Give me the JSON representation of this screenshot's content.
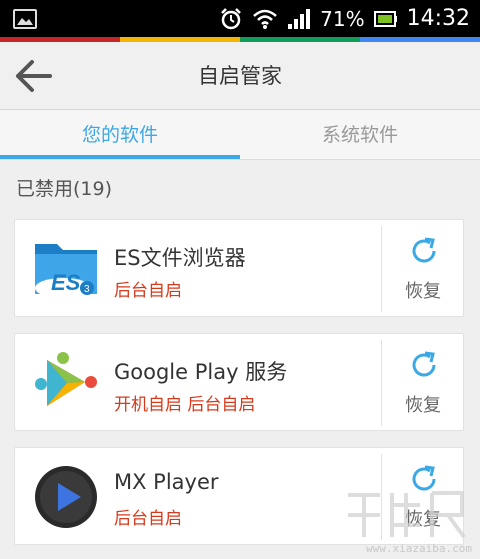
{
  "status_bar": {
    "battery_percent": "71%",
    "time": "14:32",
    "icons": [
      "gallery-icon",
      "alarm-icon",
      "wifi-icon",
      "signal-icon",
      "battery-icon"
    ],
    "strip_colors": [
      "#c62828",
      "#f4b400",
      "#0f9d58",
      "#4285f4"
    ]
  },
  "action_bar": {
    "title": "自启管家"
  },
  "tabs": [
    {
      "label": "您的软件",
      "active": true
    },
    {
      "label": "系统软件",
      "active": false
    }
  ],
  "section": {
    "title": "已禁用(19)"
  },
  "apps": [
    {
      "name": "ES文件浏览器",
      "status": "后台自启",
      "action": "恢复",
      "icon": "es-file-explorer-icon"
    },
    {
      "name": "Google Play 服务",
      "status": "开机自启 后台自启",
      "action": "恢复",
      "icon": "google-play-services-icon"
    },
    {
      "name": "MX Player",
      "status": "后台自启",
      "action": "恢复",
      "icon": "mx-player-icon"
    }
  ],
  "watermark": {
    "text": "www.xiazaiba.com"
  },
  "colors": {
    "accent": "#3aa9e6",
    "status_red": "#d63a1c"
  }
}
